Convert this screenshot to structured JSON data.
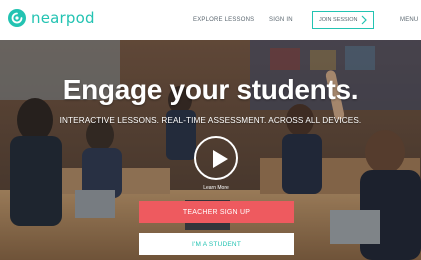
{
  "header": {
    "logo_text": "nearpod",
    "nav": {
      "explore": "EXPLORE LESSONS",
      "signin": "SIGN IN",
      "join": "JOIN SESSION",
      "menu": "MENU"
    }
  },
  "hero": {
    "headline": "Engage your students.",
    "subline": "INTERACTIVE LESSONS. REAL-TIME ASSESSMENT. ACROSS ALL DEVICES.",
    "learn_more": "Learn More",
    "teacher_button": "TEACHER SIGN UP",
    "student_button": "I'M A STUDENT"
  },
  "colors": {
    "brand_teal": "#23c3b2",
    "teacher_red": "#ee5a5f",
    "nav_text": "#5b6770"
  },
  "icons": [
    "nearpod-logo-icon",
    "arrow-right-icon",
    "menu-icon",
    "play-icon"
  ]
}
